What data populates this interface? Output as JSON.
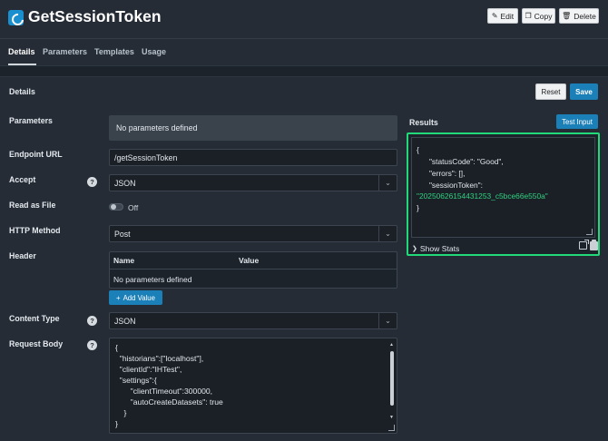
{
  "header": {
    "title": "GetSessionToken",
    "edit_label": "Edit",
    "copy_label": "Copy",
    "delete_label": "Delete"
  },
  "tabs": [
    {
      "label": "Details",
      "active": true
    },
    {
      "label": "Parameters",
      "active": false
    },
    {
      "label": "Templates",
      "active": false
    },
    {
      "label": "Usage",
      "active": false
    }
  ],
  "details": {
    "section_title": "Details",
    "reset_label": "Reset",
    "save_label": "Save",
    "parameters": {
      "label": "Parameters",
      "empty_text": "No parameters defined"
    },
    "endpoint_url": {
      "label": "Endpoint URL",
      "value": "/getSessionToken"
    },
    "accept": {
      "label": "Accept",
      "help": "?",
      "value": "JSON"
    },
    "read_as_file": {
      "label": "Read as File",
      "state_text": "Off",
      "on": false
    },
    "http_method": {
      "label": "HTTP Method",
      "value": "Post"
    },
    "header": {
      "label": "Header",
      "columns": [
        "Name",
        "Value"
      ],
      "empty_text": "No parameters defined",
      "add_value_label": "Add Value"
    },
    "content_type": {
      "label": "Content Type",
      "help": "?",
      "value": "JSON"
    },
    "request_body": {
      "label": "Request Body",
      "help": "?",
      "lines": [
        "{",
        "  \"historians\":[\"localhost\"],",
        "  \"clientId\":\"IHTest\",",
        "  \"settings\":{",
        "       \"clientTimeout\":300000,",
        "       \"autoCreateDatasets\": true",
        "    }",
        "}"
      ]
    }
  },
  "results": {
    "label": "Results",
    "test_input_label": "Test Input",
    "lines": [
      "{",
      "      \"statusCode\": \"Good\",",
      "      \"errors\": [],",
      "      \"sessionToken\":"
    ],
    "token_value": "\"20250626154431253_c5bce66e550a\"",
    "closing": "}",
    "show_stats_label": "Show Stats"
  },
  "colors": {
    "accent": "#1b7fb8",
    "highlight_border": "#22d97a",
    "token_green": "#2fd07f",
    "background": "#252c35"
  }
}
